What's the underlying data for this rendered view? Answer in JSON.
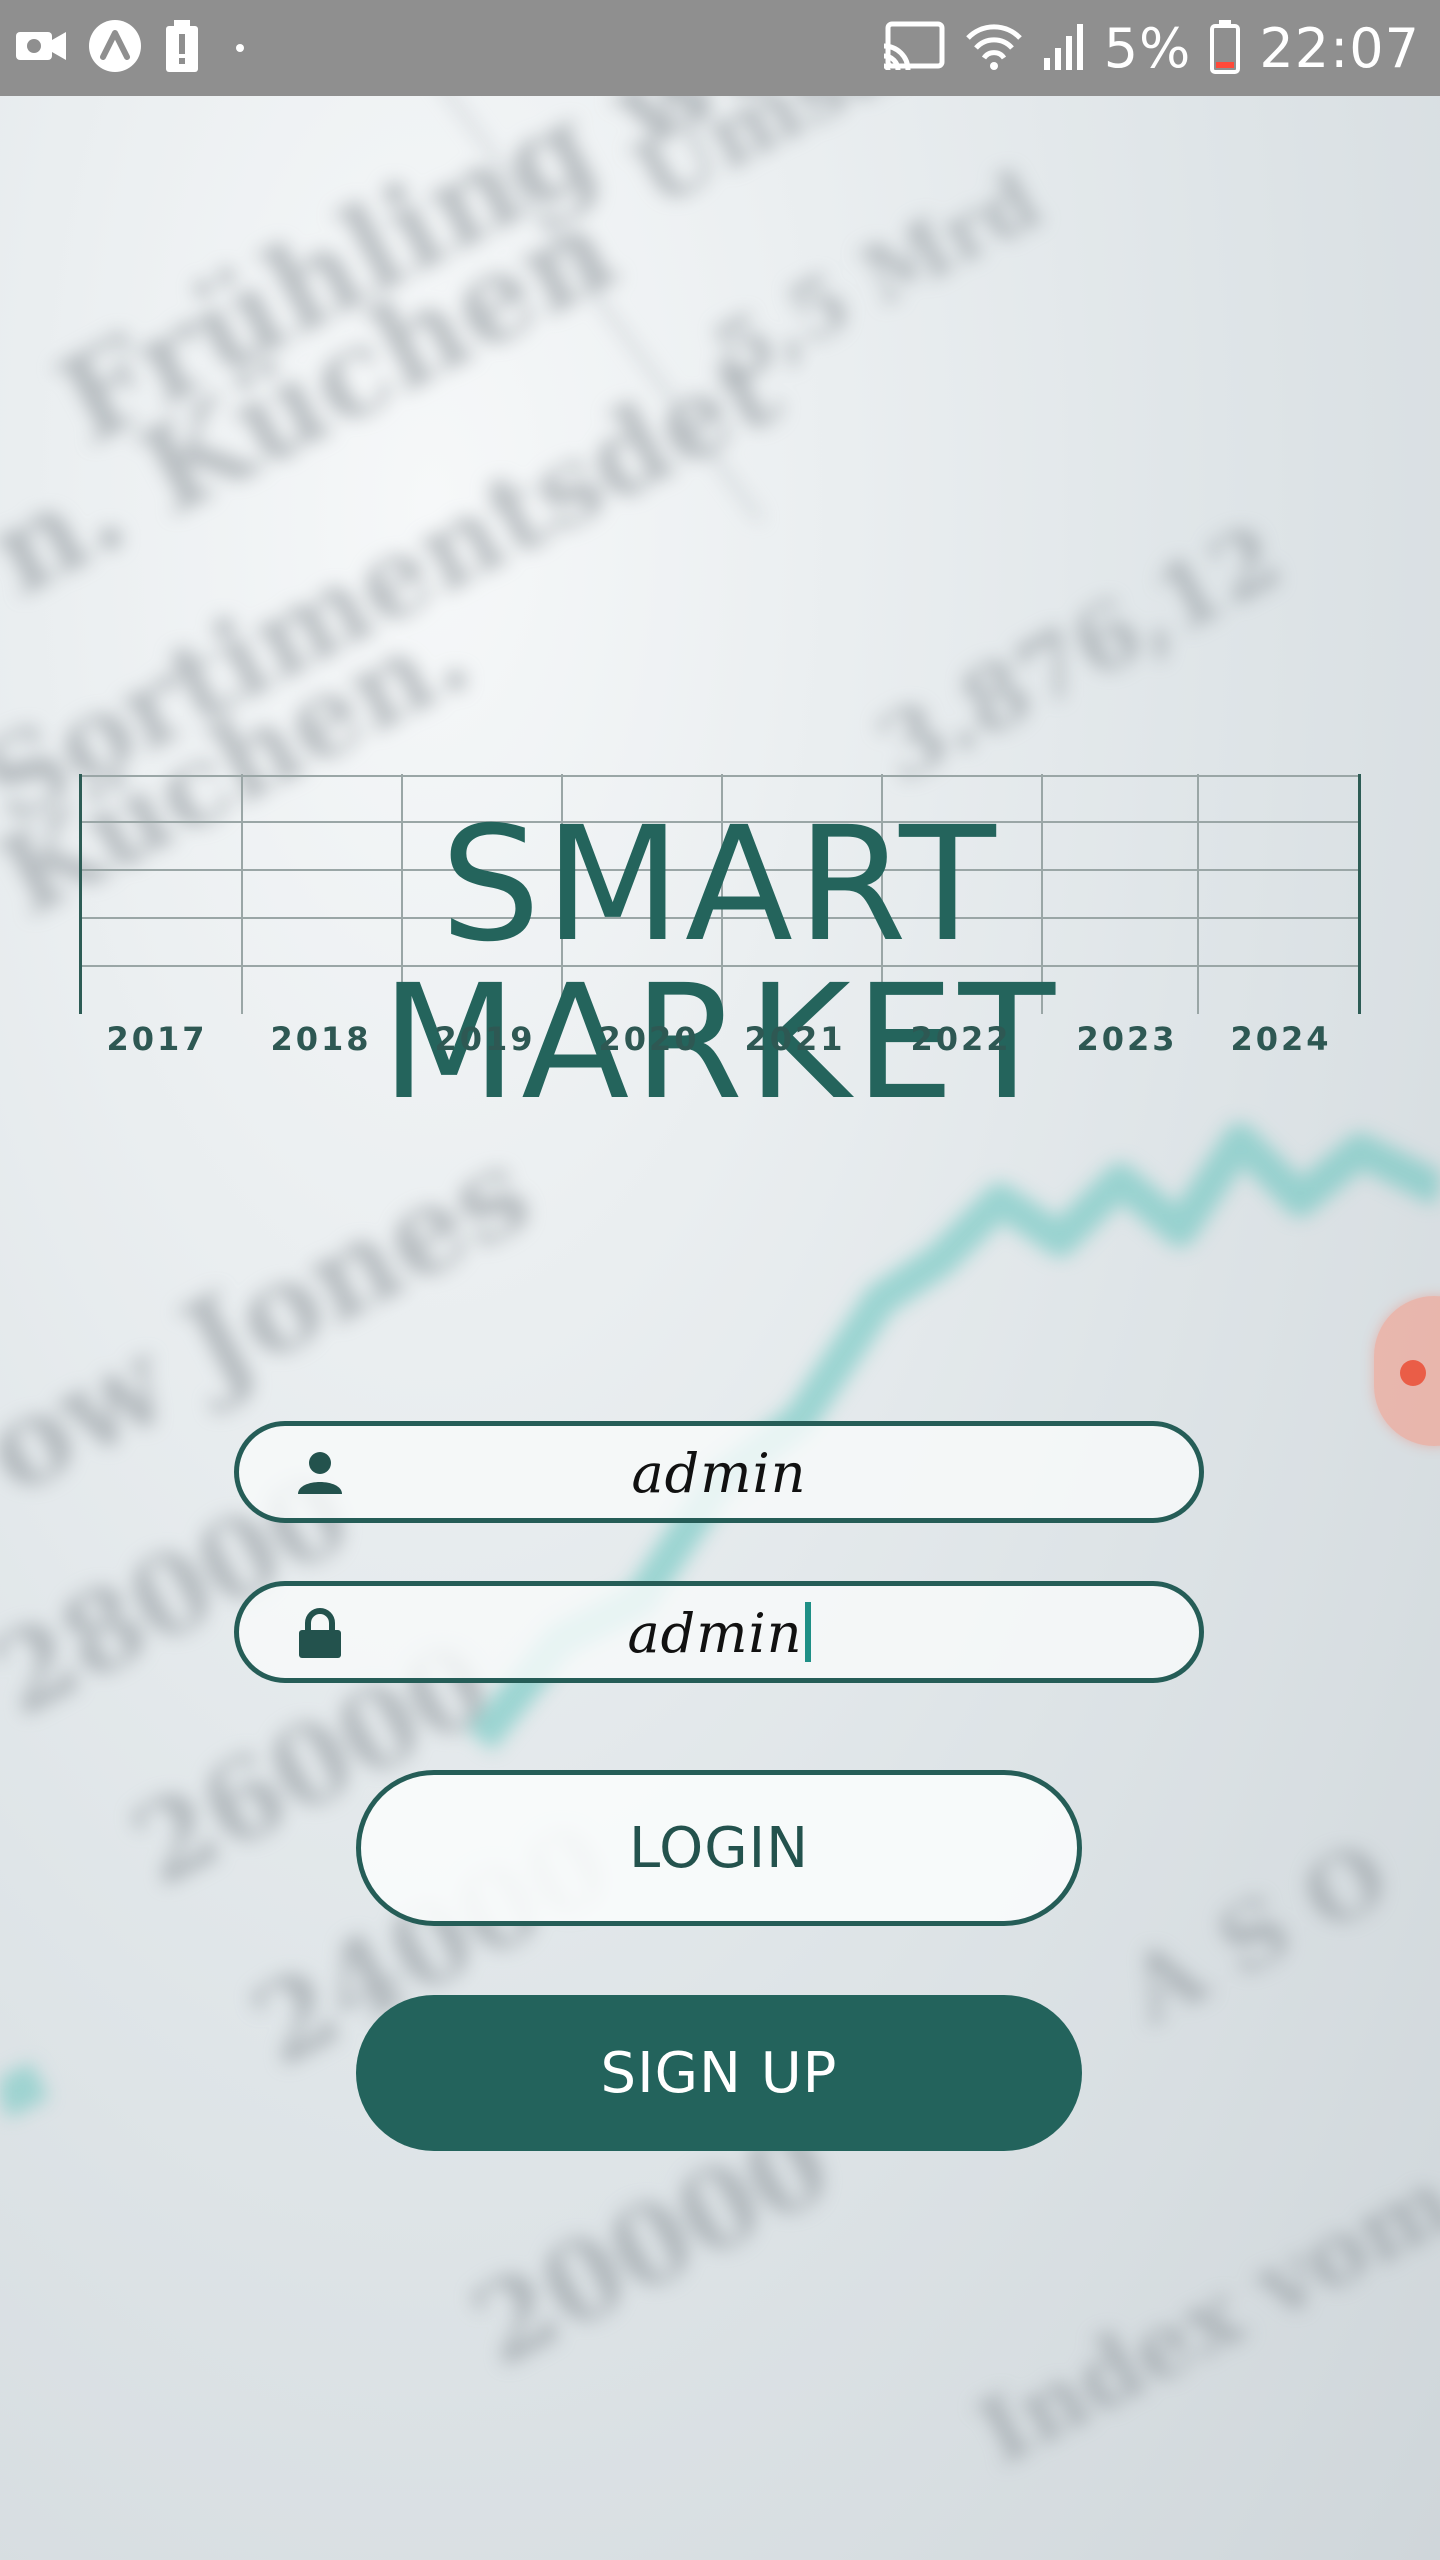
{
  "status_bar": {
    "icons_left": [
      "camera-icon",
      "arc-icon",
      "battery-alert-icon",
      "dot-icon"
    ],
    "icons_right": [
      "cast-icon",
      "wifi-icon",
      "signal-icon"
    ],
    "battery": "5%",
    "time": "22:07"
  },
  "logo": {
    "title": "SMART MARKET",
    "years": [
      "2017",
      "2018",
      "2019",
      "2020",
      "2021",
      "2022",
      "2023",
      "2024"
    ]
  },
  "login_form": {
    "username": {
      "icon": "user-icon",
      "value": "admin"
    },
    "password": {
      "icon": "lock-icon",
      "value": "admin"
    },
    "login_label": "LOGIN",
    "signup_label": "SIGN UP"
  },
  "colors": {
    "accent": "#23635c",
    "border": "#255d57",
    "status_bar": "#8f8f8f"
  }
}
